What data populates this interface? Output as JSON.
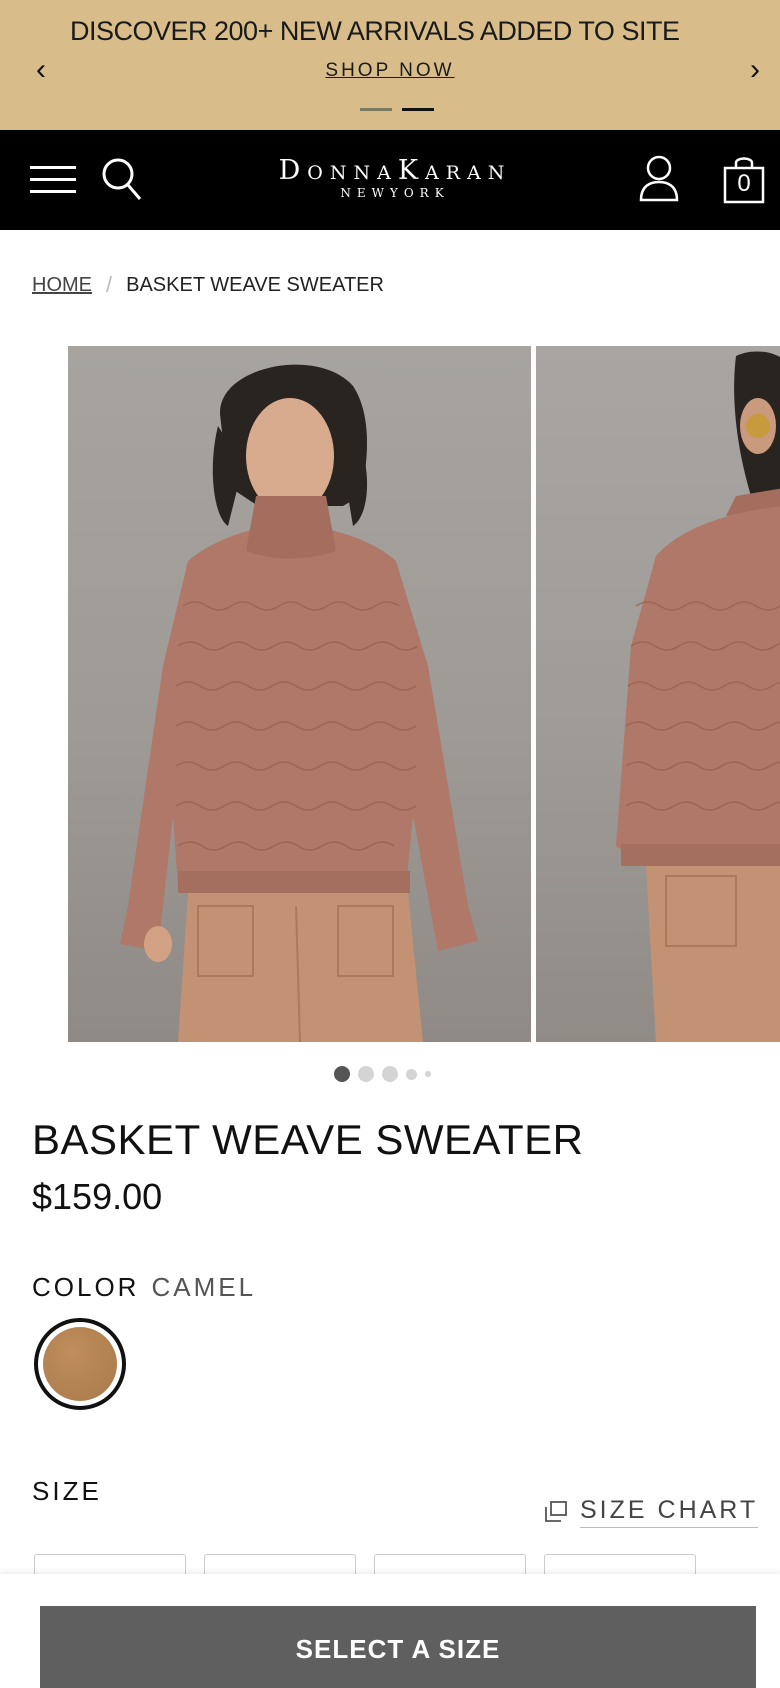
{
  "promo": {
    "message": "DISCOVER 200+ NEW ARRIVALS ADDED TO SITE",
    "link_label": "SHOP NOW",
    "prev_arrow": "‹",
    "next_arrow": "›",
    "slide_count": 2,
    "active_slide": 2
  },
  "header": {
    "logo_main": "DonnaKaran",
    "logo_sub": "NEWYORK",
    "bag_count": "0",
    "icons": [
      "menu-icon",
      "search-icon",
      "account-icon",
      "shopping-bag-icon"
    ]
  },
  "breadcrumb": {
    "home": "HOME",
    "separator": "/",
    "current": "BASKET WEAVE SWEATER"
  },
  "gallery": {
    "image_count": 5,
    "active_index": 1
  },
  "product": {
    "title": "BASKET WEAVE SWEATER",
    "price": "$159.00",
    "color_label": "COLOR",
    "color_value": "CAMEL",
    "swatch_color": "#b3834f",
    "size_label": "SIZE",
    "size_chart_label": "SIZE CHART"
  },
  "cta": {
    "select_size_label": "SELECT A SIZE",
    "button_color": "#5f5f5f"
  },
  "colors": {
    "promo_bg": "#d8bd8a",
    "header_bg": "#000000",
    "sweater": "#b07868",
    "pants": "#c39275"
  }
}
